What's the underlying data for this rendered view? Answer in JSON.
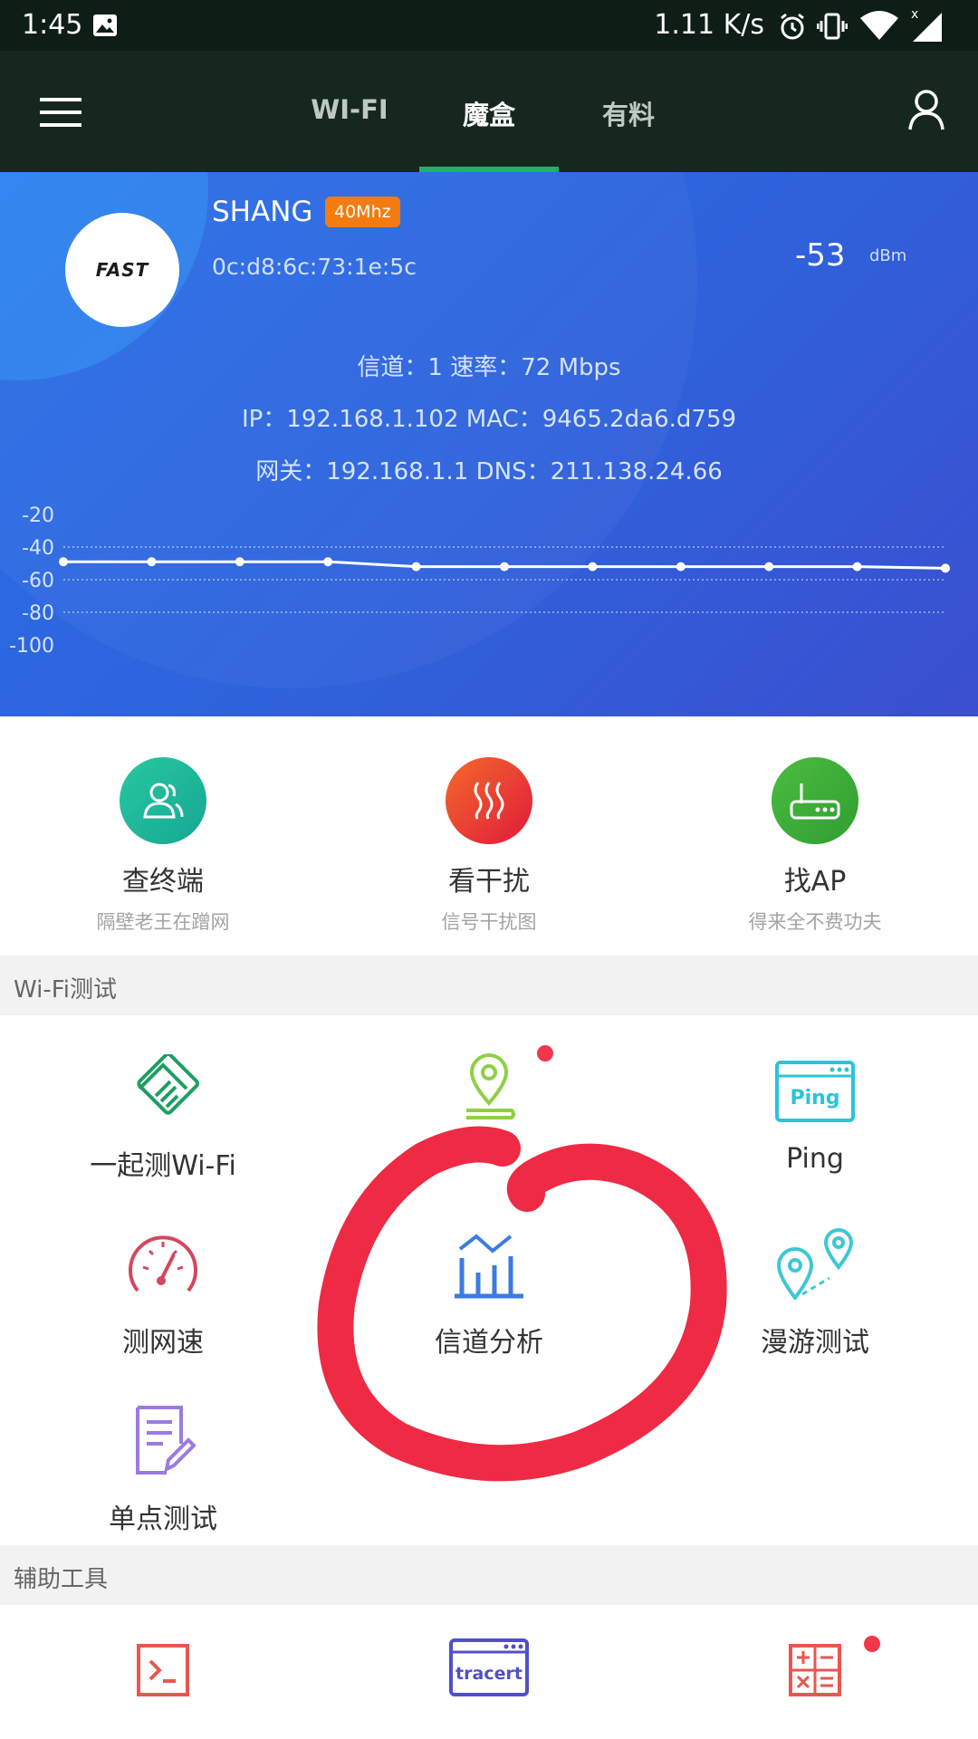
{
  "status_bar": {
    "time": "1:45",
    "net_speed": "1.11 K/s"
  },
  "tabs": [
    {
      "label": "WI-FI",
      "active": false
    },
    {
      "label": "魔盒",
      "active": true
    },
    {
      "label": "有料",
      "active": false
    }
  ],
  "network": {
    "logo_text": "FAST",
    "ssid": "SHANG",
    "bandwidth_badge": "40Mhz",
    "bssid": "0c:d8:6c:73:1e:5c",
    "signal_value": "-53",
    "signal_unit": "dBm",
    "info_line1": "信道：1   速率：72 Mbps",
    "info_line2": "IP：192.168.1.102   MAC：9465.2da6.d759",
    "info_line3": "网关：192.168.1.1   DNS：211.138.24.66"
  },
  "chart_data": {
    "type": "line",
    "y_ticks": [
      "-20",
      "-40",
      "-60",
      "-80",
      "-100"
    ],
    "ylim": [
      -100,
      -20
    ],
    "x": [
      1,
      2,
      3,
      4,
      5,
      6,
      7,
      8,
      9,
      10,
      11
    ],
    "series": [
      {
        "values": [
          -49,
          -49,
          -49,
          -49,
          -52,
          -52,
          -52,
          -52,
          -52,
          -52,
          -53
        ]
      }
    ],
    "grid_lines": [
      -40,
      -60,
      -80
    ]
  },
  "shortcuts": [
    {
      "title": "查终端",
      "subtitle": "隔壁老王在蹭网",
      "color": "#1fbf9c",
      "icon": "users-icon"
    },
    {
      "title": "看干扰",
      "subtitle": "信号干扰图",
      "color": "#ef4530",
      "icon": "heat-waves-icon"
    },
    {
      "title": "找AP",
      "subtitle": "得来全不费功夫",
      "color": "#3fae3a",
      "icon": "router-icon"
    }
  ],
  "sections": {
    "wifi_test": "Wi-Fi测试",
    "aux_tools": "辅助工具"
  },
  "wifi_tools": [
    {
      "label": "一起测Wi-Fi",
      "icon": "handshake-icon",
      "color": "#1f9e63"
    },
    {
      "label": "",
      "icon": "location-pin-icon",
      "color": "#8fcf45",
      "badge": true
    },
    {
      "label": "Ping",
      "icon": "ping-window-icon",
      "color": "#2bc4d8",
      "icon_text": "Ping"
    },
    {
      "label": "测网速",
      "icon": "speedometer-icon",
      "color": "#d4475f"
    },
    {
      "label": "信道分析",
      "icon": "channel-chart-icon",
      "color": "#3c7be0"
    },
    {
      "label": "漫游测试",
      "icon": "roaming-pins-icon",
      "color": "#3ec7d4"
    },
    {
      "label": "单点测试",
      "icon": "document-edit-icon",
      "color": "#9b7be0"
    }
  ],
  "aux_tools": [
    {
      "label": "",
      "icon": "terminal-icon",
      "color": "#e8574f"
    },
    {
      "label": "",
      "icon": "tracert-window-icon",
      "color": "#5050c8",
      "icon_text": "tracert"
    },
    {
      "label": "",
      "icon": "calculator-icon",
      "color": "#e8574f",
      "badge": true
    }
  ],
  "annotation_color": "#ee2a44"
}
